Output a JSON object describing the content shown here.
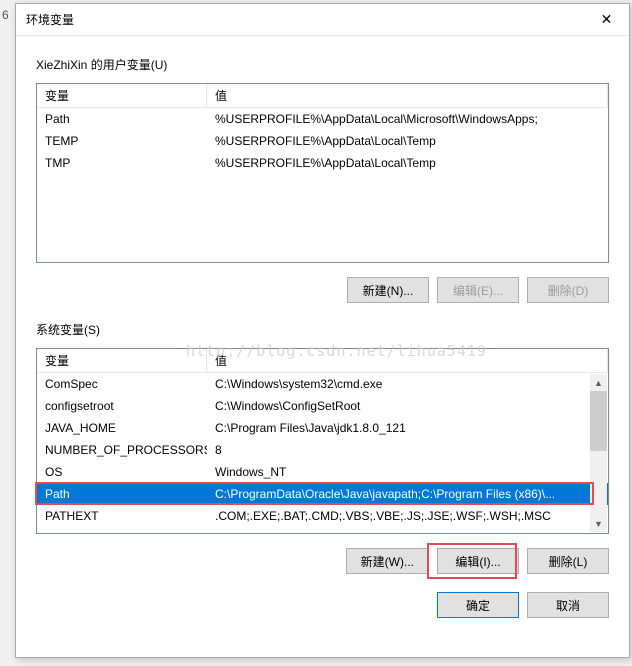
{
  "dialog": {
    "title": "环境变量",
    "close_icon": "✕"
  },
  "user_vars": {
    "label": "XieZhiXin 的用户变量(U)",
    "header_var": "变量",
    "header_val": "值",
    "rows": [
      {
        "name": "Path",
        "value": "%USERPROFILE%\\AppData\\Local\\Microsoft\\WindowsApps;"
      },
      {
        "name": "TEMP",
        "value": "%USERPROFILE%\\AppData\\Local\\Temp"
      },
      {
        "name": "TMP",
        "value": "%USERPROFILE%\\AppData\\Local\\Temp"
      }
    ],
    "buttons": {
      "new": "新建(N)...",
      "edit": "编辑(E)...",
      "delete": "删除(D)"
    }
  },
  "sys_vars": {
    "label": "系统变量(S)",
    "header_var": "变量",
    "header_val": "值",
    "rows": [
      {
        "name": "ComSpec",
        "value": "C:\\Windows\\system32\\cmd.exe"
      },
      {
        "name": "configsetroot",
        "value": "C:\\Windows\\ConfigSetRoot"
      },
      {
        "name": "JAVA_HOME",
        "value": "C:\\Program Files\\Java\\jdk1.8.0_121"
      },
      {
        "name": "NUMBER_OF_PROCESSORS",
        "value": "8"
      },
      {
        "name": "OS",
        "value": "Windows_NT"
      },
      {
        "name": "Path",
        "value": "C:\\ProgramData\\Oracle\\Java\\javapath;C:\\Program Files (x86)\\..."
      },
      {
        "name": "PATHEXT",
        "value": ".COM;.EXE;.BAT;.CMD;.VBS;.VBE;.JS;.JSE;.WSF;.WSH;.MSC"
      }
    ],
    "selected_index": 5,
    "buttons": {
      "new": "新建(W)...",
      "edit": "编辑(I)...",
      "delete": "删除(L)"
    }
  },
  "footer": {
    "ok": "确定",
    "cancel": "取消"
  },
  "watermark": "http://blog.csdn.net/lihua5419"
}
